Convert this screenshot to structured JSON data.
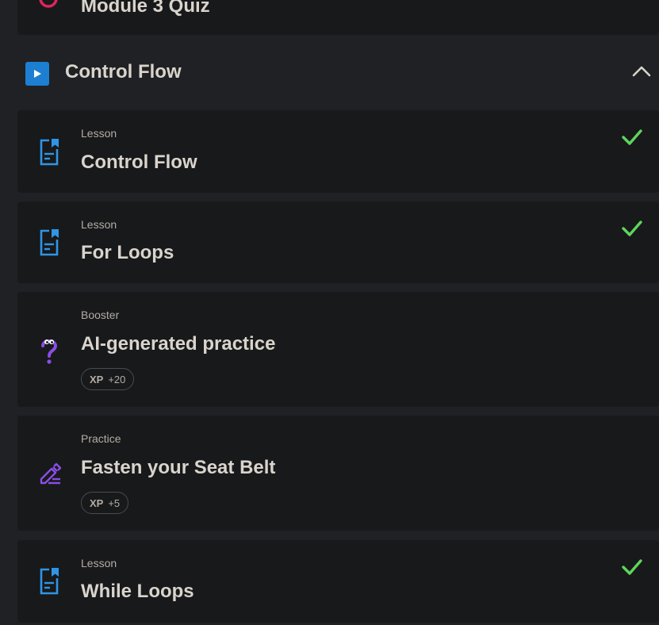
{
  "top_card": {
    "title": "Module 3 Quiz",
    "icon": "quiz-icon"
  },
  "module": {
    "title": "Control Flow",
    "icon": "play-icon",
    "expanded": true
  },
  "items": [
    {
      "kind": "Lesson",
      "title": "Control Flow",
      "icon": "lesson-icon",
      "completed": true
    },
    {
      "kind": "Lesson",
      "title": "For Loops",
      "icon": "lesson-icon",
      "completed": true
    },
    {
      "kind": "Booster",
      "title": "AI-generated practice",
      "icon": "booster-icon",
      "xp_label": "XP",
      "xp_value": "+20",
      "completed": false
    },
    {
      "kind": "Practice",
      "title": "Fasten your Seat Belt",
      "icon": "practice-icon",
      "xp_label": "XP",
      "xp_value": "+5",
      "completed": false
    },
    {
      "kind": "Lesson",
      "title": "While Loops",
      "icon": "lesson-icon",
      "completed": true
    }
  ],
  "colors": {
    "background": "#202124",
    "card": "#18191b",
    "accent_blue": "#1d7fd1",
    "lesson_icon": "#2f95e6",
    "check_green": "#5ed65a",
    "purple": "#8a4de6",
    "quiz_red": "#e0245e"
  }
}
